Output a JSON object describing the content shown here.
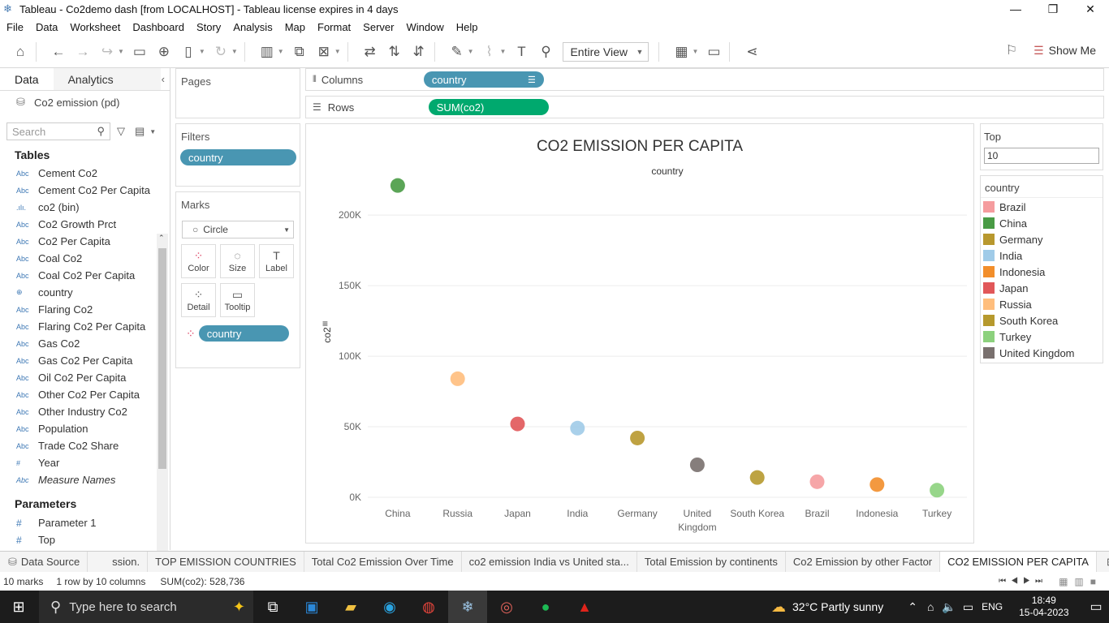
{
  "window": {
    "title": "Tableau - Co2demo dash [from LOCALHOST] - Tableau license expires in 4 days"
  },
  "menu": [
    "File",
    "Data",
    "Worksheet",
    "Dashboard",
    "Story",
    "Analysis",
    "Map",
    "Format",
    "Server",
    "Window",
    "Help"
  ],
  "toolbar": {
    "fit_value": "Entire View",
    "show_me": "Show Me"
  },
  "data_pane": {
    "tab_data": "Data",
    "tab_analytics": "Analytics",
    "datasource": "Co2 emission (pd)",
    "search_placeholder": "Search",
    "tables_header": "Tables",
    "fields": [
      {
        "type": "Abc",
        "name": "Cement Co2"
      },
      {
        "type": "Abc",
        "name": "Cement Co2 Per Capita"
      },
      {
        "type": ".ılı.",
        "name": "co2 (bin)"
      },
      {
        "type": "Abc",
        "name": "Co2 Growth Prct"
      },
      {
        "type": "Abc",
        "name": "Co2 Per Capita"
      },
      {
        "type": "Abc",
        "name": "Coal Co2"
      },
      {
        "type": "Abc",
        "name": "Coal Co2 Per Capita"
      },
      {
        "type": "⊕",
        "name": "country"
      },
      {
        "type": "Abc",
        "name": "Flaring Co2"
      },
      {
        "type": "Abc",
        "name": "Flaring Co2 Per Capita"
      },
      {
        "type": "Abc",
        "name": "Gas Co2"
      },
      {
        "type": "Abc",
        "name": "Gas Co2 Per Capita"
      },
      {
        "type": "Abc",
        "name": "Oil Co2 Per Capita"
      },
      {
        "type": "Abc",
        "name": "Other Co2 Per Capita"
      },
      {
        "type": "Abc",
        "name": "Other Industry Co2"
      },
      {
        "type": "Abc",
        "name": "Population"
      },
      {
        "type": "Abc",
        "name": "Trade Co2 Share"
      },
      {
        "type": "#",
        "name": "Year"
      },
      {
        "type": "Abc",
        "name": "Measure Names"
      }
    ],
    "parameters_header": "Parameters",
    "parameters": [
      {
        "type": "#",
        "name": "Parameter 1"
      },
      {
        "type": "#",
        "name": "Top"
      }
    ]
  },
  "shelves": {
    "pages": "Pages",
    "filters": "Filters",
    "filter_pill": "country",
    "marks": "Marks",
    "mark_type": "Circle",
    "mark_buttons": [
      "Color",
      "Size",
      "Label",
      "Detail",
      "Tooltip"
    ],
    "marks_pill": "country",
    "columns_label": "Columns",
    "columns_pill": "country",
    "rows_label": "Rows",
    "rows_pill": "SUM(co2)"
  },
  "top_param": {
    "title": "Top",
    "value": "10"
  },
  "legend": {
    "title": "country",
    "items": [
      {
        "name": "Brazil",
        "color": "#f59c9e"
      },
      {
        "name": "China",
        "color": "#499b45"
      },
      {
        "name": "Germany",
        "color": "#b8982e"
      },
      {
        "name": "India",
        "color": "#a0cbe8"
      },
      {
        "name": "Indonesia",
        "color": "#f28e2b"
      },
      {
        "name": "Japan",
        "color": "#e15759"
      },
      {
        "name": "Russia",
        "color": "#ffbe7d"
      },
      {
        "name": "South Korea",
        "color": "#b6992d"
      },
      {
        "name": "Turkey",
        "color": "#8cd17d"
      },
      {
        "name": "United Kingdom",
        "color": "#79706e"
      }
    ]
  },
  "chart_data": {
    "type": "scatter",
    "title": "CO2 EMISSION PER CAPITA",
    "xlabel": "country",
    "ylabel": "co2",
    "categories": [
      "China",
      "Russia",
      "Japan",
      "India",
      "Germany",
      "United Kingdom",
      "South Korea",
      "Brazil",
      "Indonesia",
      "Turkey"
    ],
    "values": [
      221000,
      84000,
      52000,
      49000,
      42000,
      23000,
      14000,
      11000,
      9000,
      5000
    ],
    "colors": [
      "#499b45",
      "#ffbe7d",
      "#e15759",
      "#a0cbe8",
      "#b8982e",
      "#79706e",
      "#b6992d",
      "#f59c9e",
      "#f28e2b",
      "#8cd17d"
    ],
    "yticks": [
      0,
      50000,
      100000,
      150000,
      200000
    ],
    "ytick_labels": [
      "0K",
      "50K",
      "100K",
      "150K",
      "200K"
    ],
    "ylim": [
      0,
      230000
    ],
    "grid": true,
    "legend_position": "right"
  },
  "sheet_tabs": [
    "Data Source",
    "ssion.",
    "TOP EMISSION COUNTRIES",
    "Total Co2 Emission Over Time",
    "co2 emission India vs United sta...",
    "Total Emission by continents",
    "Co2 Emission by other Factor",
    "CO2 EMISSION PER CAPITA"
  ],
  "status": {
    "marks": "10 marks",
    "layout": "1 row by 10 columns",
    "sum": "SUM(co2): 528,736"
  },
  "taskbar": {
    "search": "Type here to search",
    "weather": "32°C  Partly sunny",
    "lang": "ENG",
    "time": "18:49",
    "date": "15-04-2023"
  }
}
